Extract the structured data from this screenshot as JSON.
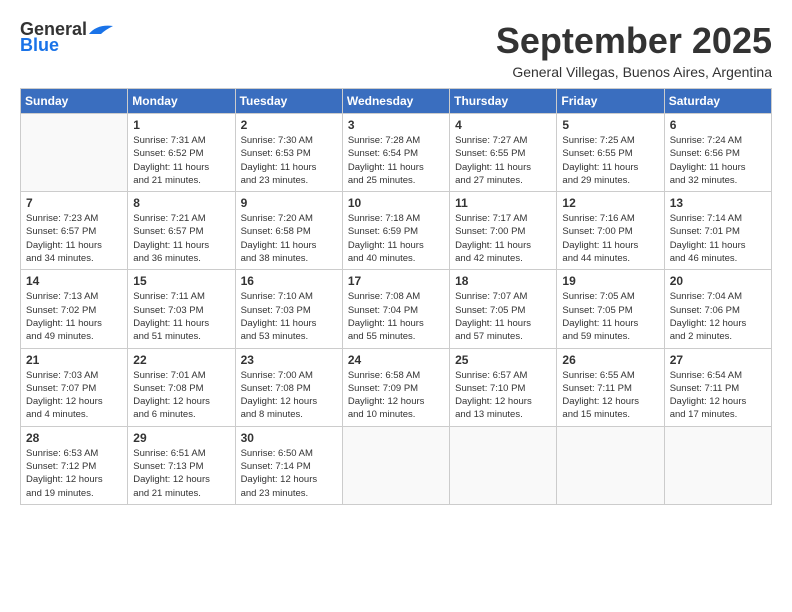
{
  "header": {
    "logo_general": "General",
    "logo_blue": "Blue",
    "month_title": "September 2025",
    "subtitle": "General Villegas, Buenos Aires, Argentina"
  },
  "weekdays": [
    "Sunday",
    "Monday",
    "Tuesday",
    "Wednesday",
    "Thursday",
    "Friday",
    "Saturday"
  ],
  "weeks": [
    [
      {
        "day": "",
        "info": ""
      },
      {
        "day": "1",
        "info": "Sunrise: 7:31 AM\nSunset: 6:52 PM\nDaylight: 11 hours\nand 21 minutes."
      },
      {
        "day": "2",
        "info": "Sunrise: 7:30 AM\nSunset: 6:53 PM\nDaylight: 11 hours\nand 23 minutes."
      },
      {
        "day": "3",
        "info": "Sunrise: 7:28 AM\nSunset: 6:54 PM\nDaylight: 11 hours\nand 25 minutes."
      },
      {
        "day": "4",
        "info": "Sunrise: 7:27 AM\nSunset: 6:55 PM\nDaylight: 11 hours\nand 27 minutes."
      },
      {
        "day": "5",
        "info": "Sunrise: 7:25 AM\nSunset: 6:55 PM\nDaylight: 11 hours\nand 29 minutes."
      },
      {
        "day": "6",
        "info": "Sunrise: 7:24 AM\nSunset: 6:56 PM\nDaylight: 11 hours\nand 32 minutes."
      }
    ],
    [
      {
        "day": "7",
        "info": "Sunrise: 7:23 AM\nSunset: 6:57 PM\nDaylight: 11 hours\nand 34 minutes."
      },
      {
        "day": "8",
        "info": "Sunrise: 7:21 AM\nSunset: 6:57 PM\nDaylight: 11 hours\nand 36 minutes."
      },
      {
        "day": "9",
        "info": "Sunrise: 7:20 AM\nSunset: 6:58 PM\nDaylight: 11 hours\nand 38 minutes."
      },
      {
        "day": "10",
        "info": "Sunrise: 7:18 AM\nSunset: 6:59 PM\nDaylight: 11 hours\nand 40 minutes."
      },
      {
        "day": "11",
        "info": "Sunrise: 7:17 AM\nSunset: 7:00 PM\nDaylight: 11 hours\nand 42 minutes."
      },
      {
        "day": "12",
        "info": "Sunrise: 7:16 AM\nSunset: 7:00 PM\nDaylight: 11 hours\nand 44 minutes."
      },
      {
        "day": "13",
        "info": "Sunrise: 7:14 AM\nSunset: 7:01 PM\nDaylight: 11 hours\nand 46 minutes."
      }
    ],
    [
      {
        "day": "14",
        "info": "Sunrise: 7:13 AM\nSunset: 7:02 PM\nDaylight: 11 hours\nand 49 minutes."
      },
      {
        "day": "15",
        "info": "Sunrise: 7:11 AM\nSunset: 7:03 PM\nDaylight: 11 hours\nand 51 minutes."
      },
      {
        "day": "16",
        "info": "Sunrise: 7:10 AM\nSunset: 7:03 PM\nDaylight: 11 hours\nand 53 minutes."
      },
      {
        "day": "17",
        "info": "Sunrise: 7:08 AM\nSunset: 7:04 PM\nDaylight: 11 hours\nand 55 minutes."
      },
      {
        "day": "18",
        "info": "Sunrise: 7:07 AM\nSunset: 7:05 PM\nDaylight: 11 hours\nand 57 minutes."
      },
      {
        "day": "19",
        "info": "Sunrise: 7:05 AM\nSunset: 7:05 PM\nDaylight: 11 hours\nand 59 minutes."
      },
      {
        "day": "20",
        "info": "Sunrise: 7:04 AM\nSunset: 7:06 PM\nDaylight: 12 hours\nand 2 minutes."
      }
    ],
    [
      {
        "day": "21",
        "info": "Sunrise: 7:03 AM\nSunset: 7:07 PM\nDaylight: 12 hours\nand 4 minutes."
      },
      {
        "day": "22",
        "info": "Sunrise: 7:01 AM\nSunset: 7:08 PM\nDaylight: 12 hours\nand 6 minutes."
      },
      {
        "day": "23",
        "info": "Sunrise: 7:00 AM\nSunset: 7:08 PM\nDaylight: 12 hours\nand 8 minutes."
      },
      {
        "day": "24",
        "info": "Sunrise: 6:58 AM\nSunset: 7:09 PM\nDaylight: 12 hours\nand 10 minutes."
      },
      {
        "day": "25",
        "info": "Sunrise: 6:57 AM\nSunset: 7:10 PM\nDaylight: 12 hours\nand 13 minutes."
      },
      {
        "day": "26",
        "info": "Sunrise: 6:55 AM\nSunset: 7:11 PM\nDaylight: 12 hours\nand 15 minutes."
      },
      {
        "day": "27",
        "info": "Sunrise: 6:54 AM\nSunset: 7:11 PM\nDaylight: 12 hours\nand 17 minutes."
      }
    ],
    [
      {
        "day": "28",
        "info": "Sunrise: 6:53 AM\nSunset: 7:12 PM\nDaylight: 12 hours\nand 19 minutes."
      },
      {
        "day": "29",
        "info": "Sunrise: 6:51 AM\nSunset: 7:13 PM\nDaylight: 12 hours\nand 21 minutes."
      },
      {
        "day": "30",
        "info": "Sunrise: 6:50 AM\nSunset: 7:14 PM\nDaylight: 12 hours\nand 23 minutes."
      },
      {
        "day": "",
        "info": ""
      },
      {
        "day": "",
        "info": ""
      },
      {
        "day": "",
        "info": ""
      },
      {
        "day": "",
        "info": ""
      }
    ]
  ]
}
